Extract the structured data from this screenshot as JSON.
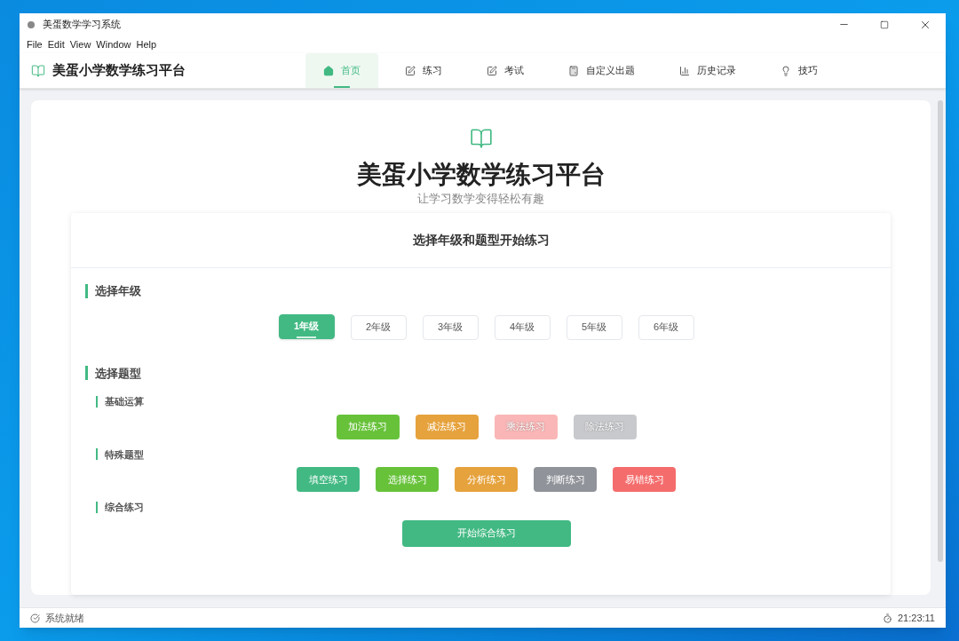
{
  "window": {
    "title": "美蛋数学学习系统"
  },
  "menu": [
    "File",
    "Edit",
    "View",
    "Window",
    "Help"
  ],
  "brand": "美蛋小学数学练习平台",
  "nav": [
    {
      "label": "首页",
      "selected": true
    },
    {
      "label": "练习",
      "selected": false
    },
    {
      "label": "考试",
      "selected": false
    },
    {
      "label": "自定义出题",
      "selected": false
    },
    {
      "label": "历史记录",
      "selected": false
    },
    {
      "label": "技巧",
      "selected": false
    }
  ],
  "hero": {
    "title": "美蛋小学数学练习平台",
    "subtitle": "让学习数学变得轻松有趣"
  },
  "panel": {
    "title": "选择年级和题型开始练习",
    "grade_heading": "选择年级",
    "grades": [
      {
        "label": "1年级",
        "selected": true
      },
      {
        "label": "2年级",
        "selected": false
      },
      {
        "label": "3年级",
        "selected": false
      },
      {
        "label": "4年级",
        "selected": false
      },
      {
        "label": "5年级",
        "selected": false
      },
      {
        "label": "6年级",
        "selected": false
      }
    ],
    "type_heading": "选择题型",
    "groups": [
      {
        "label": "基础运算",
        "buttons": [
          {
            "label": "加法练习",
            "color": "#67c23a",
            "disabled": false
          },
          {
            "label": "减法练习",
            "color": "#e6a23c",
            "disabled": false
          },
          {
            "label": "乘法练习",
            "color": "#fab6b6",
            "disabled": true
          },
          {
            "label": "除法练习",
            "color": "#c8c9cc",
            "disabled": true
          }
        ]
      },
      {
        "label": "特殊题型",
        "buttons": [
          {
            "label": "填空练习",
            "color": "#42b983",
            "disabled": false
          },
          {
            "label": "选择练习",
            "color": "#67c23a",
            "disabled": false
          },
          {
            "label": "分析练习",
            "color": "#e6a23c",
            "disabled": false
          },
          {
            "label": "判断练习",
            "color": "#909399",
            "disabled": false
          },
          {
            "label": "易错练习",
            "color": "#f56c6c",
            "disabled": false
          }
        ]
      },
      {
        "label": "综合练习",
        "buttons": [
          {
            "label": "开始综合练习",
            "color": "#42b983",
            "disabled": false,
            "kind": "wide"
          }
        ]
      }
    ]
  },
  "status_bar": {
    "message": "系统就绪",
    "time": "21:23:11"
  }
}
